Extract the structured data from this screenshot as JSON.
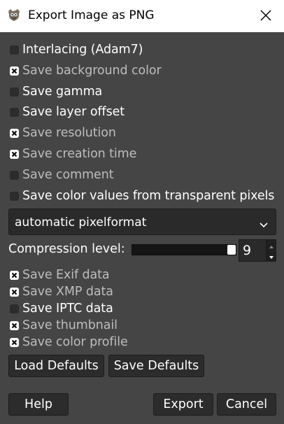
{
  "window": {
    "title": "Export Image as PNG"
  },
  "options": [
    {
      "label": "Interlacing (Adam7)",
      "checked": false,
      "dim": false
    },
    {
      "label": "Save background color",
      "checked": true,
      "dim": true
    },
    {
      "label": "Save gamma",
      "checked": false,
      "dim": false
    },
    {
      "label": "Save layer offset",
      "checked": false,
      "dim": false
    },
    {
      "label": "Save resolution",
      "checked": true,
      "dim": true
    },
    {
      "label": "Save creation time",
      "checked": true,
      "dim": true
    },
    {
      "label": "Save comment",
      "checked": false,
      "dim": true
    },
    {
      "label": "Save color values from transparent pixels",
      "checked": false,
      "dim": false
    }
  ],
  "pixelformat": {
    "selected": "automatic pixelformat"
  },
  "compression": {
    "label": "Compression level:",
    "value": "9",
    "max": 9
  },
  "metadata": [
    {
      "label": "Save Exif data",
      "checked": true,
      "dim": true
    },
    {
      "label": "Save XMP data",
      "checked": true,
      "dim": true
    },
    {
      "label": "Save IPTC data",
      "checked": false,
      "dim": false
    },
    {
      "label": "Save thumbnail",
      "checked": true,
      "dim": true
    },
    {
      "label": "Save color profile",
      "checked": true,
      "dim": true
    }
  ],
  "defaults": {
    "load_label": "Load Defaults",
    "save_label": "Save Defaults"
  },
  "actions": {
    "help_label": "Help",
    "export_label": "Export",
    "cancel_label": "Cancel"
  },
  "colors": {
    "background": "#454545",
    "titlebar": "#ffffff",
    "dim_text": "#bdbdbd"
  }
}
